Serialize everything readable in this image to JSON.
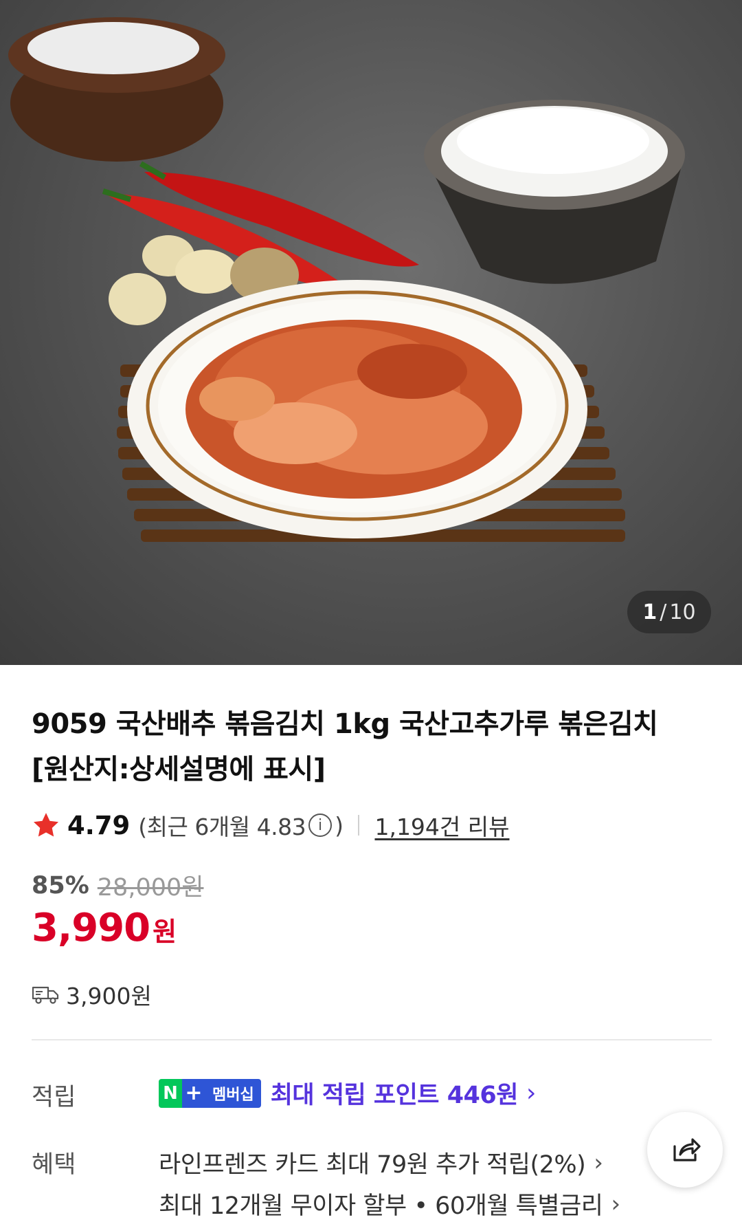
{
  "gallery": {
    "current": "1",
    "separator": "/",
    "total": "10"
  },
  "product": {
    "title_line1": "9059 국산배추 볶음김치 1kg 국산고추가루 볶은김치",
    "title_line2": "[원산지:상세설명에 표시]"
  },
  "rating": {
    "score": "4.79",
    "recent_prefix": "(최근 6개월 4.83",
    "recent_suffix": ")",
    "info_icon": "ⓘ",
    "reviews": "1,194건 리뷰"
  },
  "pricing": {
    "discount": "85%",
    "original": "28,000원",
    "price": "3,990",
    "unit": "원"
  },
  "shipping": {
    "fee": "3,900원",
    "icon": "truck-icon"
  },
  "points": {
    "label": "적립",
    "badge_n": "N",
    "badge_plus": "+",
    "badge_membership": "멤버십",
    "text": "최대 적립 포인트 446원"
  },
  "benefits": {
    "label": "혜택",
    "line1": "라인프렌즈 카드 최대 79원 추가 적립(2%)",
    "line2": "최대 12개월 무이자 할부 • 60개월 특별금리"
  },
  "colors": {
    "price_red": "#d90027",
    "points_purple": "#5533dd",
    "naver_green": "#03c75a",
    "membership_blue": "#2e55d6",
    "star": "#e8302a"
  }
}
